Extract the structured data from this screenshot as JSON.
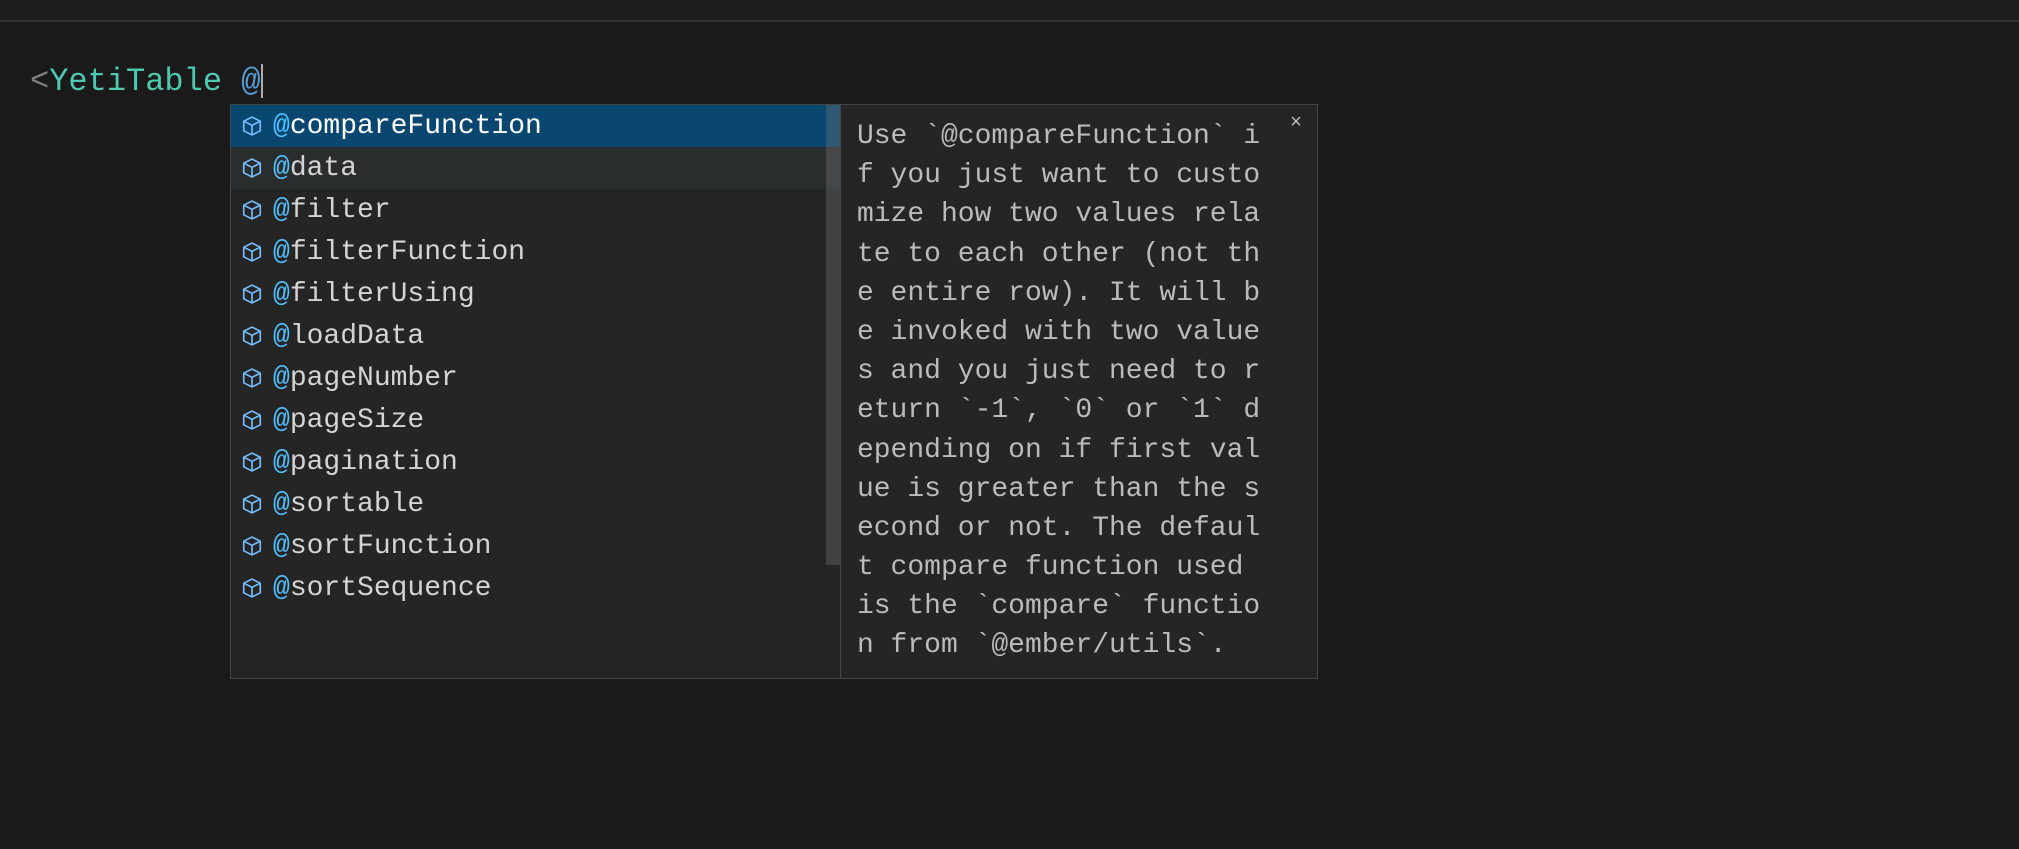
{
  "code": {
    "bracket": "<",
    "component": "YetiTable",
    "space": " ",
    "at": "@"
  },
  "suggestions": {
    "items": [
      {
        "hl": "@",
        "rest": "compareFunction",
        "selected": true
      },
      {
        "hl": "@",
        "rest": "data",
        "alt": true
      },
      {
        "hl": "@",
        "rest": "filter"
      },
      {
        "hl": "@",
        "rest": "filterFunction"
      },
      {
        "hl": "@",
        "rest": "filterUsing"
      },
      {
        "hl": "@",
        "rest": "loadData"
      },
      {
        "hl": "@",
        "rest": "pageNumber"
      },
      {
        "hl": "@",
        "rest": "pageSize"
      },
      {
        "hl": "@",
        "rest": "pagination"
      },
      {
        "hl": "@",
        "rest": "sortable"
      },
      {
        "hl": "@",
        "rest": "sortFunction"
      },
      {
        "hl": "@",
        "rest": "sortSequence"
      }
    ]
  },
  "doc": {
    "text": "Use `@compareFunction` if you just want to customize how two values relate to each other (not the entire row).\nIt will be invoked with two values and you just need to return `-1`, `0` or `1` depending on if first value is\ngreater than the second or not. The default compare function used is the `compare` function from `@ember/utils`.",
    "close": "×"
  }
}
